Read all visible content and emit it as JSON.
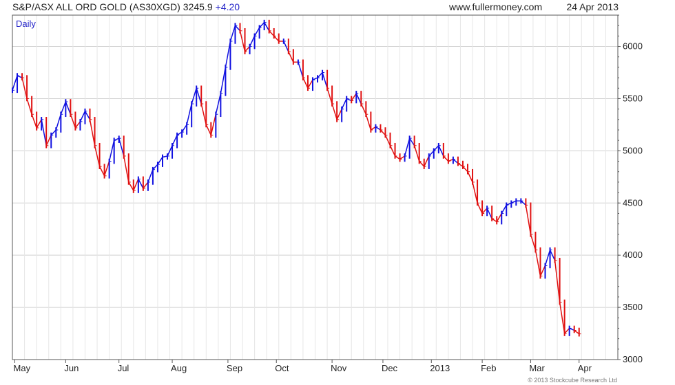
{
  "header": {
    "title": "S&P/ASX ALL ORD GOLD (AS30XGD)",
    "price": "3245.9",
    "change": "+4.20",
    "site": "www.fullermoney.com",
    "date": "24 Apr 2013"
  },
  "credit": "© 2013 Stockcube Research Ltd",
  "colors": {
    "up": "#1010e0",
    "down": "#e01010",
    "grid": "#d0d0d0",
    "border": "#555555",
    "label_accent": "#2323c8"
  },
  "chart_data": {
    "type": "line",
    "style": "OHLC price bars (red = down, blue = up)",
    "periodicity_label": "Daily",
    "ylim": [
      3000,
      6300
    ],
    "yticks": [
      3000,
      3500,
      4000,
      4500,
      5000,
      5500,
      6000
    ],
    "y_axis_side": "right",
    "grid": true,
    "month_ticks": [
      {
        "label": "May",
        "day": 1
      },
      {
        "label": "Jun",
        "day": 22
      },
      {
        "label": "Jul",
        "day": 44
      },
      {
        "label": "Aug",
        "day": 66
      },
      {
        "label": "Sep",
        "day": 89
      },
      {
        "label": "Oct",
        "day": 109
      },
      {
        "label": "Nov",
        "day": 132
      },
      {
        "label": "Dec",
        "day": 153
      },
      {
        "label": "2013",
        "day": 173
      },
      {
        "label": "Feb",
        "day": 194
      },
      {
        "label": "Mar",
        "day": 214
      },
      {
        "label": "Apr",
        "day": 234
      }
    ],
    "x_range_days": [
      0,
      250
    ],
    "series": [
      {
        "values": [
          [
            0,
            5580
          ],
          [
            2,
            5720
          ],
          [
            4,
            5700
          ],
          [
            6,
            5500
          ],
          [
            8,
            5350
          ],
          [
            10,
            5220
          ],
          [
            12,
            5300
          ],
          [
            14,
            5050
          ],
          [
            16,
            5150
          ],
          [
            18,
            5200
          ],
          [
            20,
            5350
          ],
          [
            22,
            5470
          ],
          [
            24,
            5350
          ],
          [
            26,
            5220
          ],
          [
            28,
            5280
          ],
          [
            30,
            5380
          ],
          [
            32,
            5300
          ],
          [
            34,
            5050
          ],
          [
            36,
            4850
          ],
          [
            38,
            4760
          ],
          [
            40,
            4900
          ],
          [
            42,
            5100
          ],
          [
            44,
            5120
          ],
          [
            46,
            4950
          ],
          [
            48,
            4700
          ],
          [
            50,
            4620
          ],
          [
            52,
            4730
          ],
          [
            54,
            4640
          ],
          [
            56,
            4700
          ],
          [
            58,
            4820
          ],
          [
            60,
            4870
          ],
          [
            62,
            4940
          ],
          [
            64,
            4950
          ],
          [
            66,
            5050
          ],
          [
            68,
            5150
          ],
          [
            70,
            5180
          ],
          [
            72,
            5250
          ],
          [
            74,
            5450
          ],
          [
            76,
            5600
          ],
          [
            78,
            5450
          ],
          [
            80,
            5250
          ],
          [
            82,
            5150
          ],
          [
            84,
            5350
          ],
          [
            86,
            5550
          ],
          [
            88,
            5800
          ],
          [
            90,
            6050
          ],
          [
            92,
            6200
          ],
          [
            94,
            6150
          ],
          [
            96,
            5950
          ],
          [
            98,
            6000
          ],
          [
            100,
            6100
          ],
          [
            102,
            6180
          ],
          [
            104,
            6230
          ],
          [
            106,
            6150
          ],
          [
            108,
            6100
          ],
          [
            110,
            6050
          ],
          [
            112,
            6050
          ],
          [
            114,
            5950
          ],
          [
            116,
            5850
          ],
          [
            118,
            5850
          ],
          [
            120,
            5700
          ],
          [
            122,
            5600
          ],
          [
            124,
            5680
          ],
          [
            126,
            5700
          ],
          [
            128,
            5750
          ],
          [
            130,
            5600
          ],
          [
            132,
            5450
          ],
          [
            134,
            5300
          ],
          [
            136,
            5400
          ],
          [
            138,
            5500
          ],
          [
            140,
            5480
          ],
          [
            142,
            5550
          ],
          [
            144,
            5450
          ],
          [
            146,
            5350
          ],
          [
            148,
            5200
          ],
          [
            150,
            5230
          ],
          [
            152,
            5200
          ],
          [
            154,
            5150
          ],
          [
            156,
            5050
          ],
          [
            158,
            4950
          ],
          [
            160,
            4920
          ],
          [
            162,
            4950
          ],
          [
            164,
            5120
          ],
          [
            166,
            5050
          ],
          [
            168,
            4900
          ],
          [
            170,
            4850
          ],
          [
            172,
            4950
          ],
          [
            174,
            5000
          ],
          [
            176,
            5050
          ],
          [
            178,
            4950
          ],
          [
            180,
            4900
          ],
          [
            182,
            4920
          ],
          [
            184,
            4880
          ],
          [
            186,
            4850
          ],
          [
            188,
            4800
          ],
          [
            190,
            4700
          ],
          [
            192,
            4500
          ],
          [
            194,
            4400
          ],
          [
            196,
            4450
          ],
          [
            198,
            4350
          ],
          [
            200,
            4320
          ],
          [
            202,
            4400
          ],
          [
            204,
            4480
          ],
          [
            206,
            4500
          ],
          [
            208,
            4520
          ],
          [
            210,
            4520
          ],
          [
            212,
            4480
          ],
          [
            214,
            4200
          ],
          [
            216,
            4050
          ],
          [
            218,
            3800
          ],
          [
            220,
            3900
          ],
          [
            222,
            4050
          ],
          [
            224,
            3950
          ],
          [
            226,
            3550
          ],
          [
            228,
            3250
          ],
          [
            230,
            3300
          ],
          [
            232,
            3280
          ],
          [
            234,
            3246
          ]
        ]
      }
    ]
  }
}
